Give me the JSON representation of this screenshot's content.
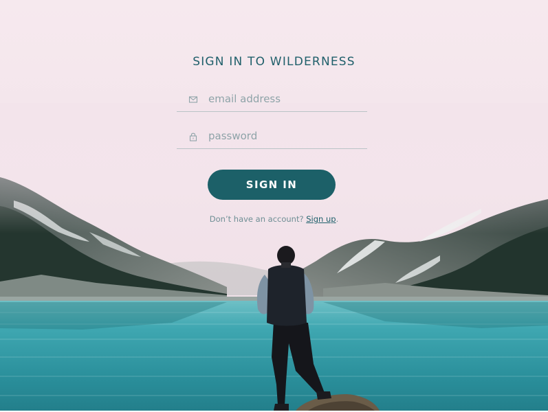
{
  "form": {
    "title": "SIGN IN TO WILDERNESS",
    "email": {
      "placeholder": "email address",
      "icon": "envelope-icon"
    },
    "password": {
      "placeholder": "password",
      "icon": "lock-icon"
    },
    "submit_label": "SIGN IN",
    "signup_prompt": "Don’t have an account?",
    "signup_link": "Sign up",
    "signup_suffix": "."
  },
  "colors": {
    "accent": "#1c6068",
    "title_text": "#1f5f6a",
    "lake": "#2e9aa6",
    "sky": "#f3e6ec"
  }
}
